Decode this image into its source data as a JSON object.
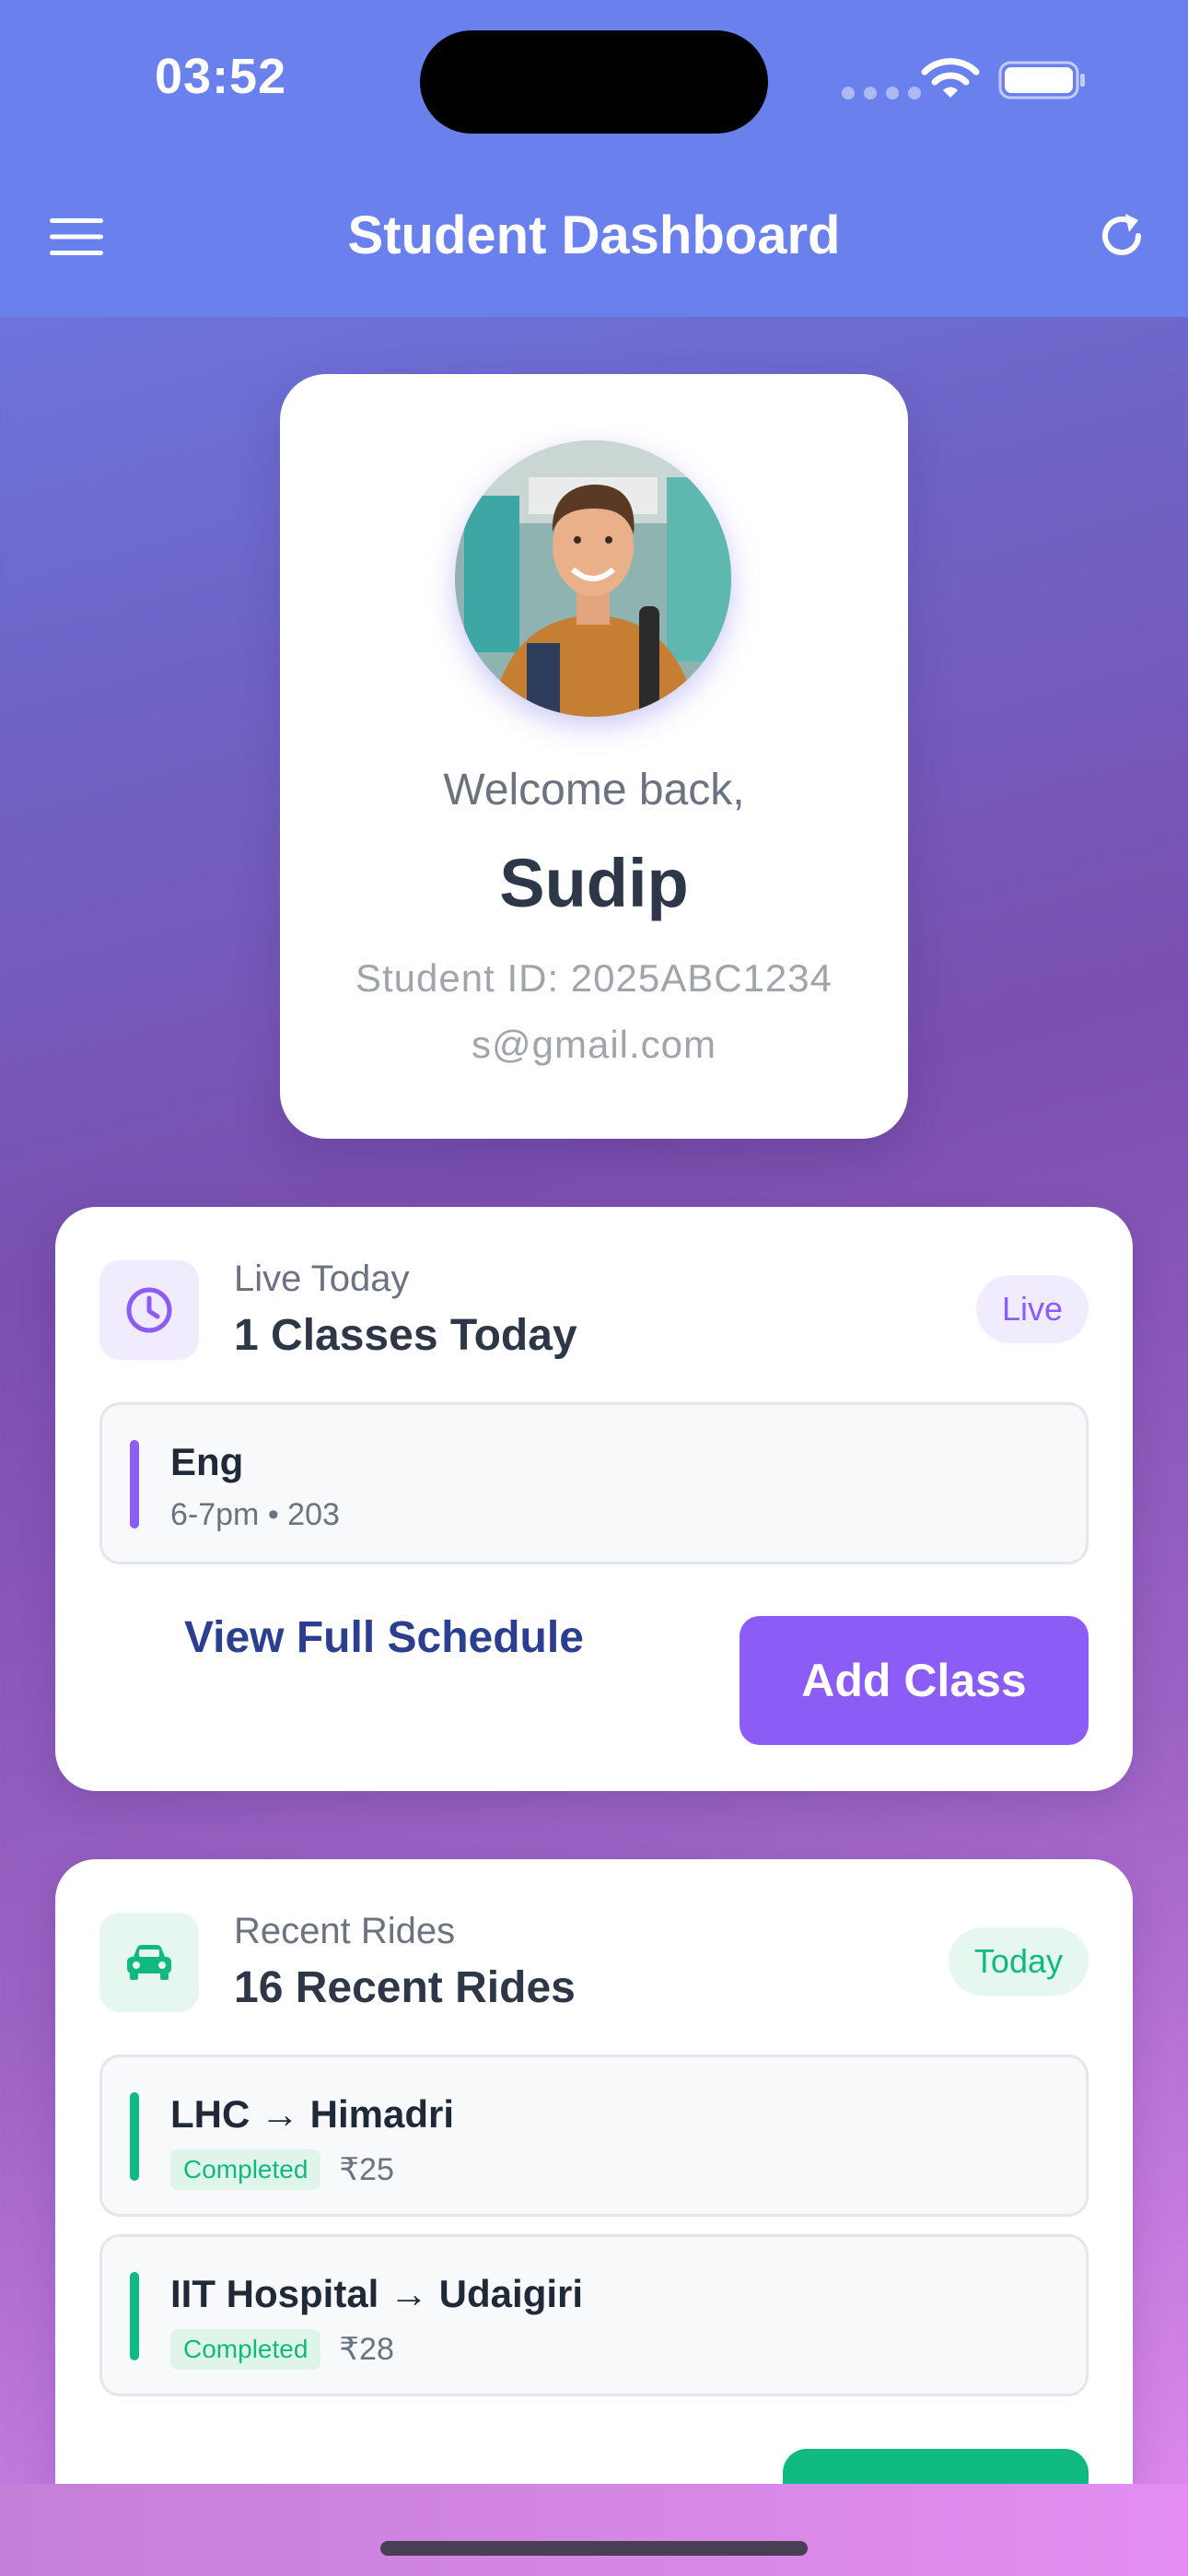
{
  "status_bar": {
    "time": "03:52"
  },
  "header": {
    "title": "Student Dashboard"
  },
  "profile": {
    "welcome": "Welcome back,",
    "name": "Sudip",
    "student_id": "Student ID: 2025ABC1234",
    "email": "s@gmail.com"
  },
  "classes": {
    "label": "Live Today",
    "title": "1 Classes Today",
    "badge": "Live",
    "items": [
      {
        "name": "Eng",
        "detail": "6-7pm • 203"
      }
    ],
    "view_schedule": "View Full Schedule",
    "add_class": "Add Class"
  },
  "rides": {
    "label": "Recent Rides",
    "title": "16 Recent Rides",
    "badge": "Today",
    "items": [
      {
        "route": "LHC → Himadri",
        "status": "Completed",
        "fare": "₹25"
      },
      {
        "route": "IIT Hospital → Udaigiri",
        "status": "Completed",
        "fare": "₹28"
      }
    ]
  },
  "colors": {
    "header": "#6a80ec",
    "primary": "#8b5cf6",
    "success": "#10b981",
    "link": "#2c3e8f"
  },
  "icons": {
    "menu": "menu-icon",
    "refresh": "refresh-icon",
    "clock": "clock-icon",
    "car": "car-icon"
  }
}
